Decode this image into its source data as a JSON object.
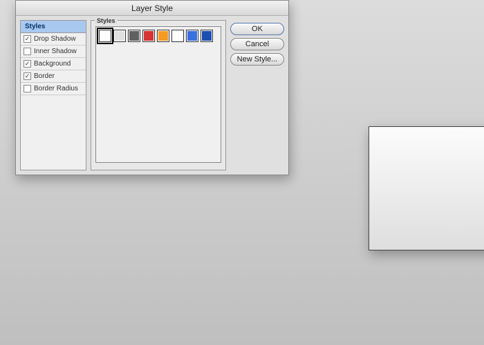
{
  "dialog": {
    "title": "Layer Style",
    "sidebar_header": "Styles",
    "items": [
      {
        "label": "Drop Shadow",
        "checked": true
      },
      {
        "label": "Inner Shadow",
        "checked": false
      },
      {
        "label": "Background",
        "checked": true
      },
      {
        "label": "Border",
        "checked": true
      },
      {
        "label": "Border Radius",
        "checked": false
      }
    ],
    "preset_label": "Styles",
    "swatches": [
      "#ffffff",
      "#e0e0e0",
      "#606060",
      "#d63333",
      "#f59a22",
      "#ffffff",
      "#3a6fe0",
      "#1d4fb0"
    ],
    "buttons": {
      "ok": "OK",
      "cancel": "Cancel",
      "new_style": "New Style..."
    }
  }
}
